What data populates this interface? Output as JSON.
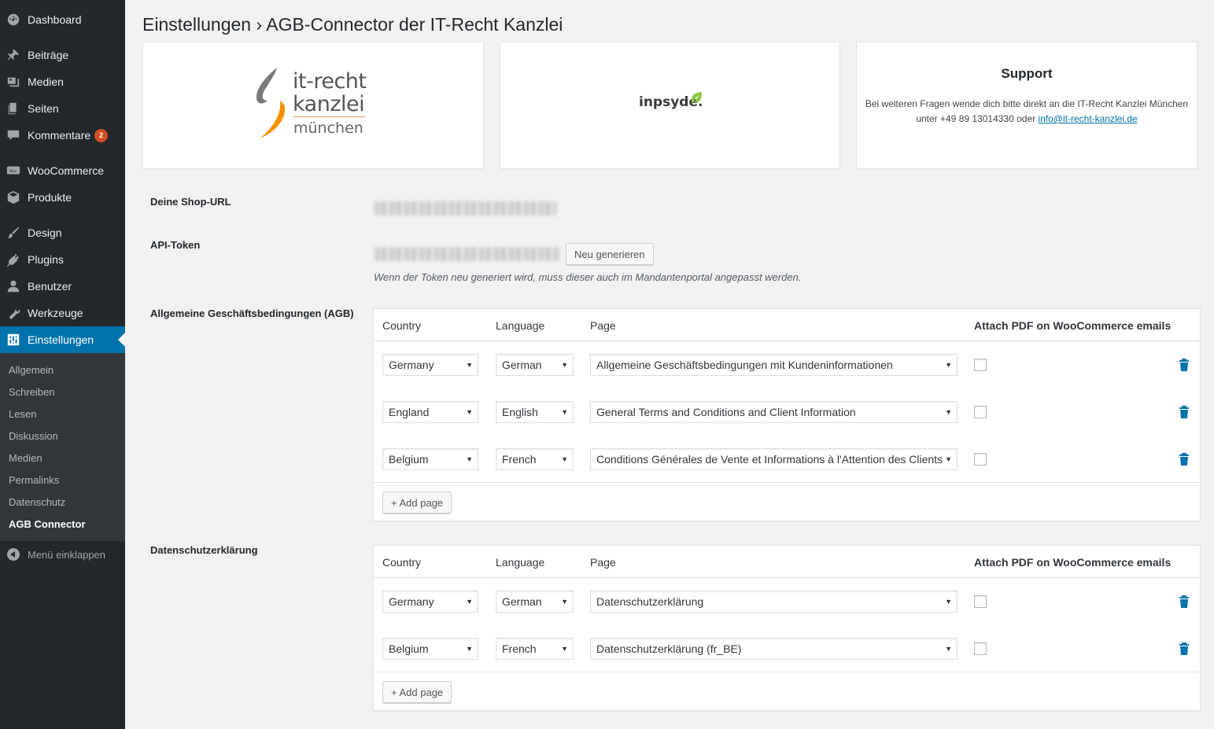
{
  "sidebar": {
    "items": [
      {
        "label": "Dashboard",
        "icon": "dashboard-icon"
      },
      {
        "label": "Beiträge",
        "icon": "pin-icon"
      },
      {
        "label": "Medien",
        "icon": "media-icon"
      },
      {
        "label": "Seiten",
        "icon": "pages-icon"
      },
      {
        "label": "Kommentare",
        "icon": "comment-icon",
        "badge": "2"
      },
      {
        "label": "WooCommerce",
        "icon": "woocommerce-icon"
      },
      {
        "label": "Produkte",
        "icon": "box-icon"
      },
      {
        "label": "Design",
        "icon": "brush-icon"
      },
      {
        "label": "Plugins",
        "icon": "plug-icon"
      },
      {
        "label": "Benutzer",
        "icon": "user-icon"
      },
      {
        "label": "Werkzeuge",
        "icon": "wrench-icon"
      },
      {
        "label": "Einstellungen",
        "icon": "settings-icon",
        "active": true
      }
    ],
    "submenu": [
      "Allgemein",
      "Schreiben",
      "Lesen",
      "Diskussion",
      "Medien",
      "Permalinks",
      "Datenschutz",
      "AGB Connector"
    ],
    "collapse_label": "Menü einklappen"
  },
  "page": {
    "title": "Einstellungen › AGB-Connector der IT-Recht Kanzlei"
  },
  "cards": {
    "itrecht_logo": {
      "line1": "it-recht",
      "line2": "kanzlei",
      "line3": "münchen"
    },
    "inpsyde_logo": {
      "text": "inpsyde."
    },
    "support": {
      "title": "Support",
      "text1": "Bei weiteren Fragen wende dich bitte direkt an die IT-Recht Kanzlei München",
      "text2": "unter +49 89 13014330 oder ",
      "email": "info@it-recht-kanzlei.de"
    }
  },
  "settings": {
    "shop_url_label": "Deine Shop-URL",
    "api_token_label": "API-Token",
    "regenerate_label": "Neu generieren",
    "token_hint": "Wenn der Token neu generiert wird, muss dieser auch im Mandantenportal angepasst werden."
  },
  "columns": {
    "country": "Country",
    "language": "Language",
    "page": "Page",
    "attach": "Attach PDF on WooCommerce emails"
  },
  "agb": {
    "label": "Allgemeine Geschäftsbedingungen (AGB)",
    "rows": [
      {
        "country": "Germany",
        "language": "German",
        "page": "Allgemeine Geschäftsbedingungen mit Kundeninformationen"
      },
      {
        "country": "England",
        "language": "English",
        "page": "General Terms and Conditions and Client Information"
      },
      {
        "country": "Belgium",
        "language": "French",
        "page": "Conditions Générales de Vente et Informations à l'Attention des Clients"
      }
    ],
    "add_label": "+ Add page"
  },
  "privacy": {
    "label": "Datenschutzerklärung",
    "rows": [
      {
        "country": "Germany",
        "language": "German",
        "page": "Datenschutzerklärung"
      },
      {
        "country": "Belgium",
        "language": "French",
        "page": "Datenschutzerklärung (fr_BE)"
      }
    ],
    "add_label": "+ Add page"
  },
  "colors": {
    "accent": "#0073aa",
    "sidebar_bg": "#23282d",
    "submenu_bg": "#32373c",
    "badge": "#d54e21",
    "logo_orange": "#f39200",
    "inpsyde_green": "#8cc63f"
  }
}
